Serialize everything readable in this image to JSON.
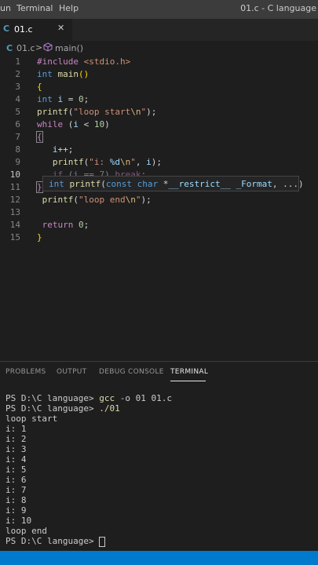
{
  "menubar": {
    "items": [
      "un",
      "Terminal",
      "Help"
    ],
    "window_title": "01.c - C language"
  },
  "tab": {
    "icon": "C",
    "label": "01.c",
    "close": "✕"
  },
  "breadcrumb": {
    "file_icon": "C",
    "file": "01.c",
    "separator": ">",
    "symbol_icon": "cube-icon",
    "symbol": "main()"
  },
  "editor": {
    "line_numbers": [
      "1",
      "2",
      "3",
      "4",
      "5",
      "6",
      "7",
      "8",
      "9",
      "10",
      "11",
      "12",
      "13",
      "14",
      "15"
    ],
    "active_line": "10",
    "tooltip": "int printf(const char *__restrict__ _Format, ...)"
  },
  "panel": {
    "tabs": [
      "PROBLEMS",
      "OUTPUT",
      "DEBUG CONSOLE",
      "TERMINAL"
    ],
    "active_tab": "TERMINAL"
  },
  "terminal": {
    "prompt": "PS D:\\C language>",
    "cmd1": "gcc",
    "cmd1_args": " -o 01 01.c",
    "cmd2": "./01",
    "output": [
      "loop start",
      "i: 1",
      "i: 2",
      "i: 3",
      "i: 4",
      "i: 5",
      "i: 6",
      "i: 7",
      "i: 8",
      "i: 9",
      "i: 10",
      "loop end"
    ]
  },
  "colors": {
    "accent": "#007acc",
    "keyword": "#569cd6",
    "control": "#c586c0",
    "function": "#dcdcaa",
    "string": "#ce9178"
  }
}
